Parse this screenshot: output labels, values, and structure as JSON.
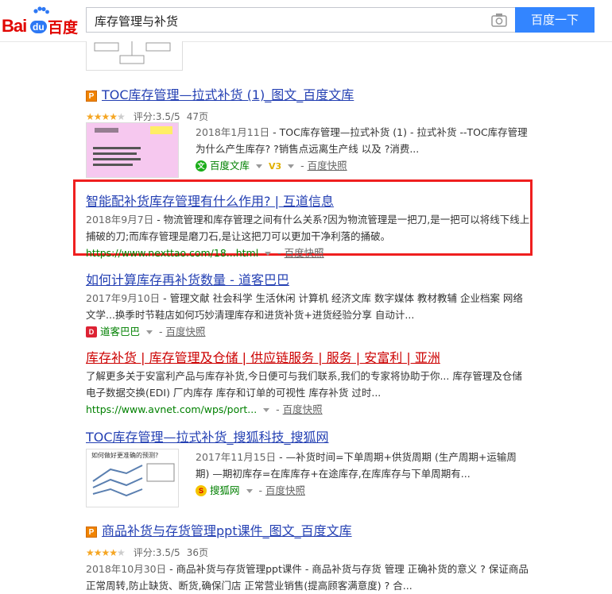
{
  "header": {
    "logo_text": "Baidu百度",
    "logo_parts": {
      "bai": "Bai",
      "du": "du",
      "cn": "百度"
    },
    "query": "库存管理与补货",
    "search_button": "百度一下",
    "camera_icon": "camera-icon"
  },
  "results": [
    {
      "title": "TOC库存管理—拉式补货 (1)_图文_百度文库",
      "rating_stars": 3.5,
      "rating_text": "评分:3.5/5",
      "pages": "47页",
      "date": "2018年1月11日",
      "abstract": " - TOC库存管理—拉式补货 (1) - 拉式补货 --TOC库存管理 为什么产生库存? ?销售点远离生产线 以及 ?消费...",
      "source": "百度文库",
      "source_badge": "V3",
      "snapshot": "百度快照"
    },
    {
      "title": "智能配补货库存管理有什么作用? | 互道信息",
      "date": "2018年9月7日",
      "abstract": " - 物流管理和库存管理之间有什么关系?因为物流管理是一把刀,是一把可以将线下线上捕破的刀;而库存管理是磨刀石,是让这把刀可以更加干净利落的捅破。",
      "url": "https://www.nexttao.com/18...html",
      "snapshot": "百度快照"
    },
    {
      "title": "如何计算库存再补货数量 - 道客巴巴",
      "date": "2017年9月10日",
      "abstract": " - 管理文献 社会科学 生活休闲 计算机 经济文库 数字媒体 教材教辅 企业档案 网络文学...换季时节鞋店如何巧妙清理库存和进货补货+进货经验分享 自动计...",
      "source": "道客巴巴",
      "snapshot": "百度快照"
    },
    {
      "title": "库存补货 | 库存管理及仓储 | 供应链服务 | 服务 | 安富利 | 亚洲",
      "abstract": "了解更多关于安富利产品与库存补货,今日便可与我们联系,我们的专家将协助于你... 库存管理及仓储 电子数据交换(EDI) 厂内库存 库存和订单的可视性 库存补货 过时...",
      "url": "https://www.avnet.com/wps/port...",
      "snapshot": "百度快照"
    },
    {
      "title": "TOC库存管理—拉式补货_搜狐科技_搜狐网",
      "date": "2017年11月15日",
      "abstract": " - —补货时间=下单周期+供货周期 (生产周期+运输周期) —期初库存=在库库存+在途库存,在库库存与下单周期有...",
      "source": "搜狐网",
      "snapshot": "百度快照",
      "thumb_caption": "如何做好更准确的预测?"
    },
    {
      "title": "商品补货与存货管理ppt课件_图文_百度文库",
      "rating_stars": 3.5,
      "rating_text": "评分:3.5/5",
      "pages": "36页",
      "date": "2018年10月30日",
      "abstract": " - 商品补货与存货管理ppt课件 - 商品补货与存货 管理 正确补货的意义 ? 保证商品正常周转,防止缺货、断货,确保门店 正常营业销售(提高顾客满意度) ? 合..."
    }
  ],
  "colors": {
    "accent": "#3385ff",
    "title": "#2440b3",
    "keyword": "#cc0000",
    "url": "#008000",
    "highlight": "#ef1f1f"
  }
}
